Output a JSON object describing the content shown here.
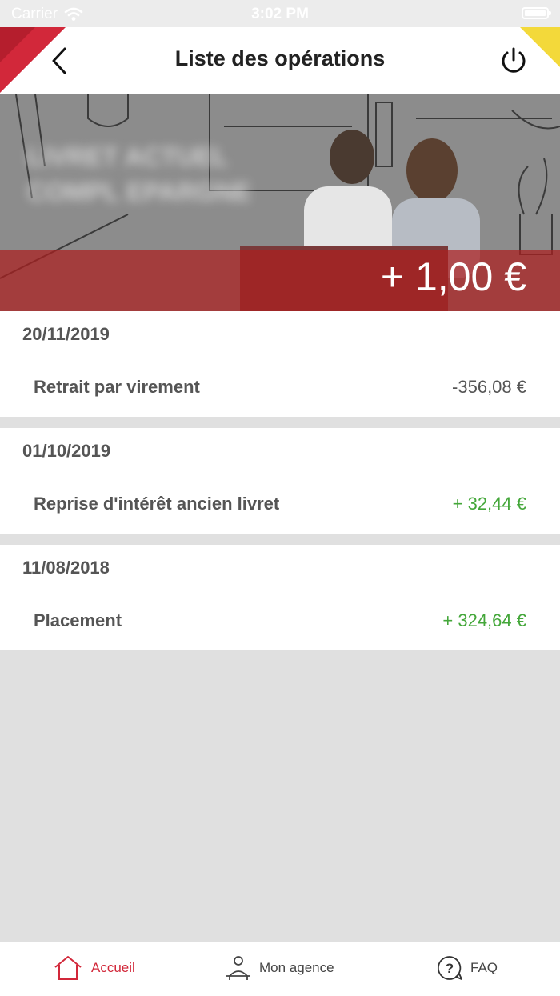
{
  "status_bar": {
    "carrier": "Carrier",
    "time": "3:02 PM"
  },
  "header": {
    "title": "Liste des opérations"
  },
  "account": {
    "name_blurred": "LIVRET ACTUEL COMPL EPARGNE",
    "balance": "+ 1,00 €"
  },
  "operations": [
    {
      "date": "20/11/2019",
      "items": [
        {
          "label": "Retrait par virement",
          "amount": "-356,08 €",
          "positive": false
        }
      ]
    },
    {
      "date": "01/10/2019",
      "items": [
        {
          "label": "Reprise d'intérêt ancien livret",
          "amount": "+ 32,44 €",
          "positive": true
        }
      ]
    },
    {
      "date": "11/08/2018",
      "items": [
        {
          "label": "Placement",
          "amount": "+ 324,64 €",
          "positive": true
        }
      ]
    }
  ],
  "tabbar": {
    "home": "Accueil",
    "agency": "Mon agence",
    "faq": "FAQ"
  },
  "colors": {
    "brand_red": "#d2283a",
    "positive_green": "#44a73a",
    "accent_yellow": "#f3d93a"
  },
  "icons": {
    "back": "chevron-left-icon",
    "power": "power-icon",
    "home": "home-icon",
    "agency": "person-icon",
    "faq": "question-bubble-icon"
  }
}
